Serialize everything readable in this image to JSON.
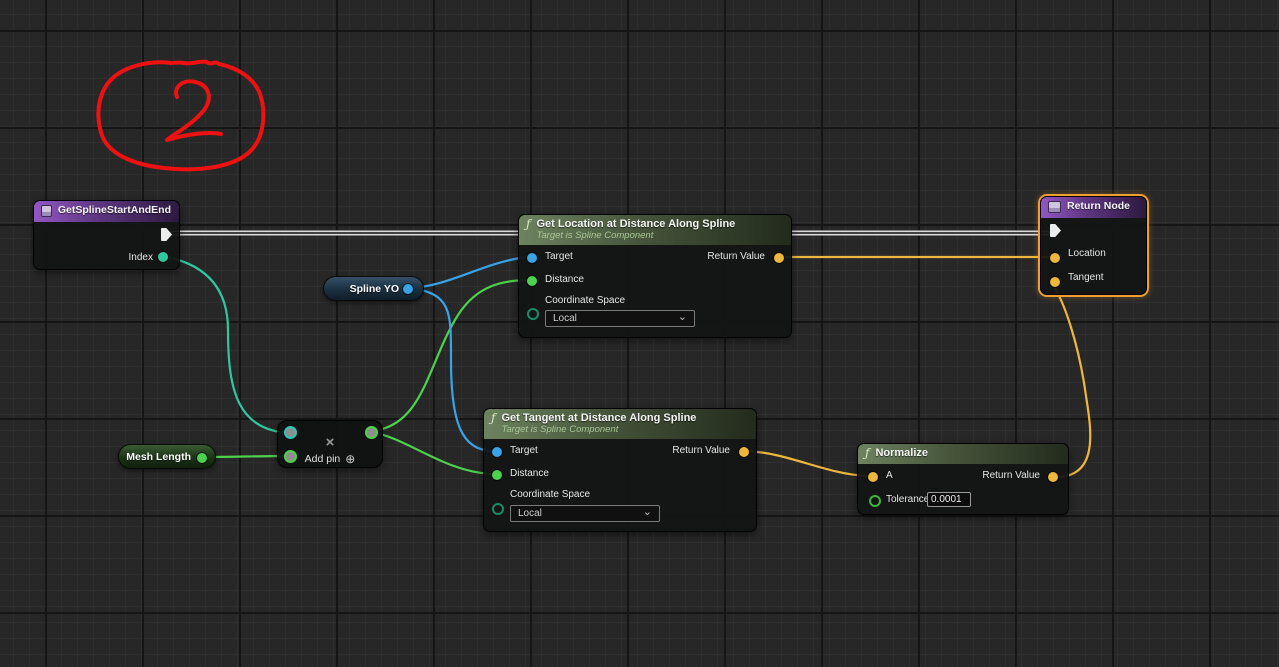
{
  "annotation": {
    "value": "2"
  },
  "icons": {
    "function": "ƒ",
    "add_pin": "⊕",
    "chevron_down": "⌄"
  },
  "nodes": {
    "entry": {
      "title": "GetSplineStartAndEnd",
      "pins": {
        "index": "Index"
      }
    },
    "spline_yo": {
      "label": "Spline YO"
    },
    "mesh_length": {
      "label": "Mesh Length"
    },
    "multiply": {
      "operator": "×",
      "add_pin_label": "Add pin"
    },
    "get_location": {
      "title": "Get Location at Distance Along Spline",
      "subtitle": "Target is Spline Component",
      "pins": {
        "target": "Target",
        "distance": "Distance",
        "coordinate_space": "Coordinate Space",
        "return_value": "Return Value"
      },
      "coordinate_space_value": "Local"
    },
    "get_tangent": {
      "title": "Get Tangent at Distance Along Spline",
      "subtitle": "Target is Spline Component",
      "pins": {
        "target": "Target",
        "distance": "Distance",
        "coordinate_space": "Coordinate Space",
        "return_value": "Return Value"
      },
      "coordinate_space_value": "Local"
    },
    "normalize": {
      "title": "Normalize",
      "pins": {
        "a": "A",
        "tolerance": "Tolerance",
        "return_value": "Return Value"
      },
      "tolerance_value": "0.0001"
    },
    "return_node": {
      "title": "Return Node",
      "pins": {
        "location": "Location",
        "tangent": "Tangent"
      }
    }
  },
  "colors": {
    "exec_wire": "#d9d9d9",
    "vector_wire": "#edb63c",
    "float_wire": "#4cd24c",
    "object_wire": "#39a3e8",
    "int_wire": "#2fc79e",
    "annotation_red": "#ee1111",
    "selection_orange": "#ed9f35"
  }
}
